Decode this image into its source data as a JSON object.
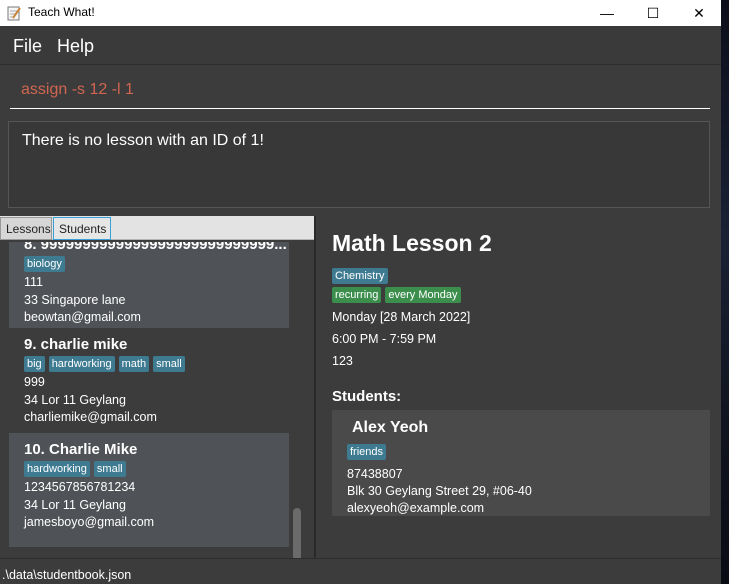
{
  "window": {
    "title": "Teach What!",
    "minimize": "—",
    "maximize": "☐",
    "close": "✕"
  },
  "menu": {
    "file": "File",
    "help": "Help"
  },
  "command": {
    "value": "assign -s 12 -l 1"
  },
  "result": {
    "text": "There is no lesson with an ID of 1!"
  },
  "tabs": {
    "lessons": "Lessons",
    "students": "Students"
  },
  "students": [
    {
      "name": "8.  9999999999999999999999999999...",
      "tags": [
        "biology"
      ],
      "phone": "111",
      "address": "33 Singapore lane",
      "email": "beowtan@gmail.com"
    },
    {
      "name": "9.  charlie mike",
      "tags": [
        "big",
        "hardworking",
        "math",
        "small"
      ],
      "phone": "999",
      "address": "34 Lor 11 Geylang",
      "email": "charliemike@gmail.com"
    },
    {
      "name": "10.  Charlie Mike",
      "tags": [
        "hardworking",
        "small"
      ],
      "phone": "1234567856781234",
      "address": "34 Lor 11 Geylang",
      "email": "jamesboyo@gmail.com"
    }
  ],
  "lesson": {
    "title": "Math Lesson 2",
    "subject": "Chemistry",
    "type": "recurring",
    "frequency": "every Monday",
    "date": "Monday [28 March 2022]",
    "time": "6:00 PM - 7:59 PM",
    "rate": "123",
    "students_heading": "Students:",
    "student": {
      "name": "Alex Yeoh",
      "tag": "friends",
      "phone": "87438807",
      "address": "Blk 30 Geylang Street 29, #06-40",
      "email": "alexyeoh@example.com"
    }
  },
  "status": {
    "path": ".\\data\\studentbook.json"
  },
  "colors": {
    "tag_blue": "#3e7b91",
    "tag_green": "#3c8e4d",
    "command_text": "#d06651"
  }
}
